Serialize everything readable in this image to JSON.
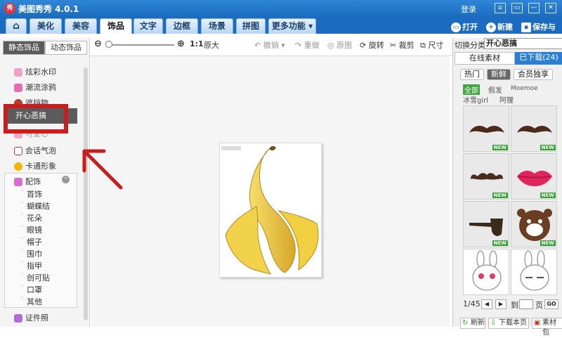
{
  "app": {
    "title": "美图秀秀 4.0.1",
    "logo_text": "秀",
    "login": "登录"
  },
  "window_buttons": [
    "⌂",
    "▭",
    "—",
    "✕"
  ],
  "tabs": [
    {
      "label": "⌂"
    },
    {
      "label": "美化"
    },
    {
      "label": "美容"
    },
    {
      "label": "饰品"
    },
    {
      "label": "文字"
    },
    {
      "label": "边框"
    },
    {
      "label": "场景"
    },
    {
      "label": "拼图"
    },
    {
      "label": "更多功能 ▾"
    }
  ],
  "right_toolbar": {
    "open": "打开",
    "new": "新建",
    "save_share": "保存与分"
  },
  "zoom": {
    "ratio": "1:1",
    "original_size": "原大"
  },
  "edit_tools": {
    "undo": "撤销",
    "redo": "重做",
    "original": "原图",
    "rotate": "旋转",
    "crop": "裁剪",
    "size": "尺寸"
  },
  "left_panel": {
    "tab_static": "静态饰品",
    "tab_dynamic": "动态饰品",
    "items": [
      "炫彩水印",
      "潮流涂鸦",
      "遮挡物"
    ],
    "selected": "开心恶搞",
    "hidden_item": "可爱心",
    "items_after": [
      "会话气泡",
      "卡通形象"
    ],
    "accessories_label": "配饰",
    "subitems": [
      "首饰",
      "蝴蝶结",
      "花朵",
      "眼镜",
      "帽子",
      "围巾",
      "指甲",
      "创可贴",
      "口罩",
      "其他"
    ],
    "certificate_photo": "证件照"
  },
  "right_panel": {
    "switch_category_label": "切换分类",
    "category_value": "开心恶搞",
    "tab_online": "在线素材",
    "tab_downloaded": "已下载(24)",
    "pills": [
      "热门",
      "新鲜",
      "会员独享"
    ],
    "filters": [
      "全部",
      "假发",
      "Moemoe",
      "冰雪girl",
      "阿狸"
    ],
    "new_badge": "NEW",
    "pager": {
      "page_info": "1/45",
      "to": "到",
      "page": "页",
      "go": "GO"
    },
    "bottom_buttons": [
      "刷新",
      "下载本页",
      "素材包"
    ]
  },
  "colors": {
    "title_blue": "#1b6cc0",
    "highlight_red": "#c81e1e",
    "new_green": "#2fa52f",
    "tab_active_blue": "#2b7fd6"
  }
}
